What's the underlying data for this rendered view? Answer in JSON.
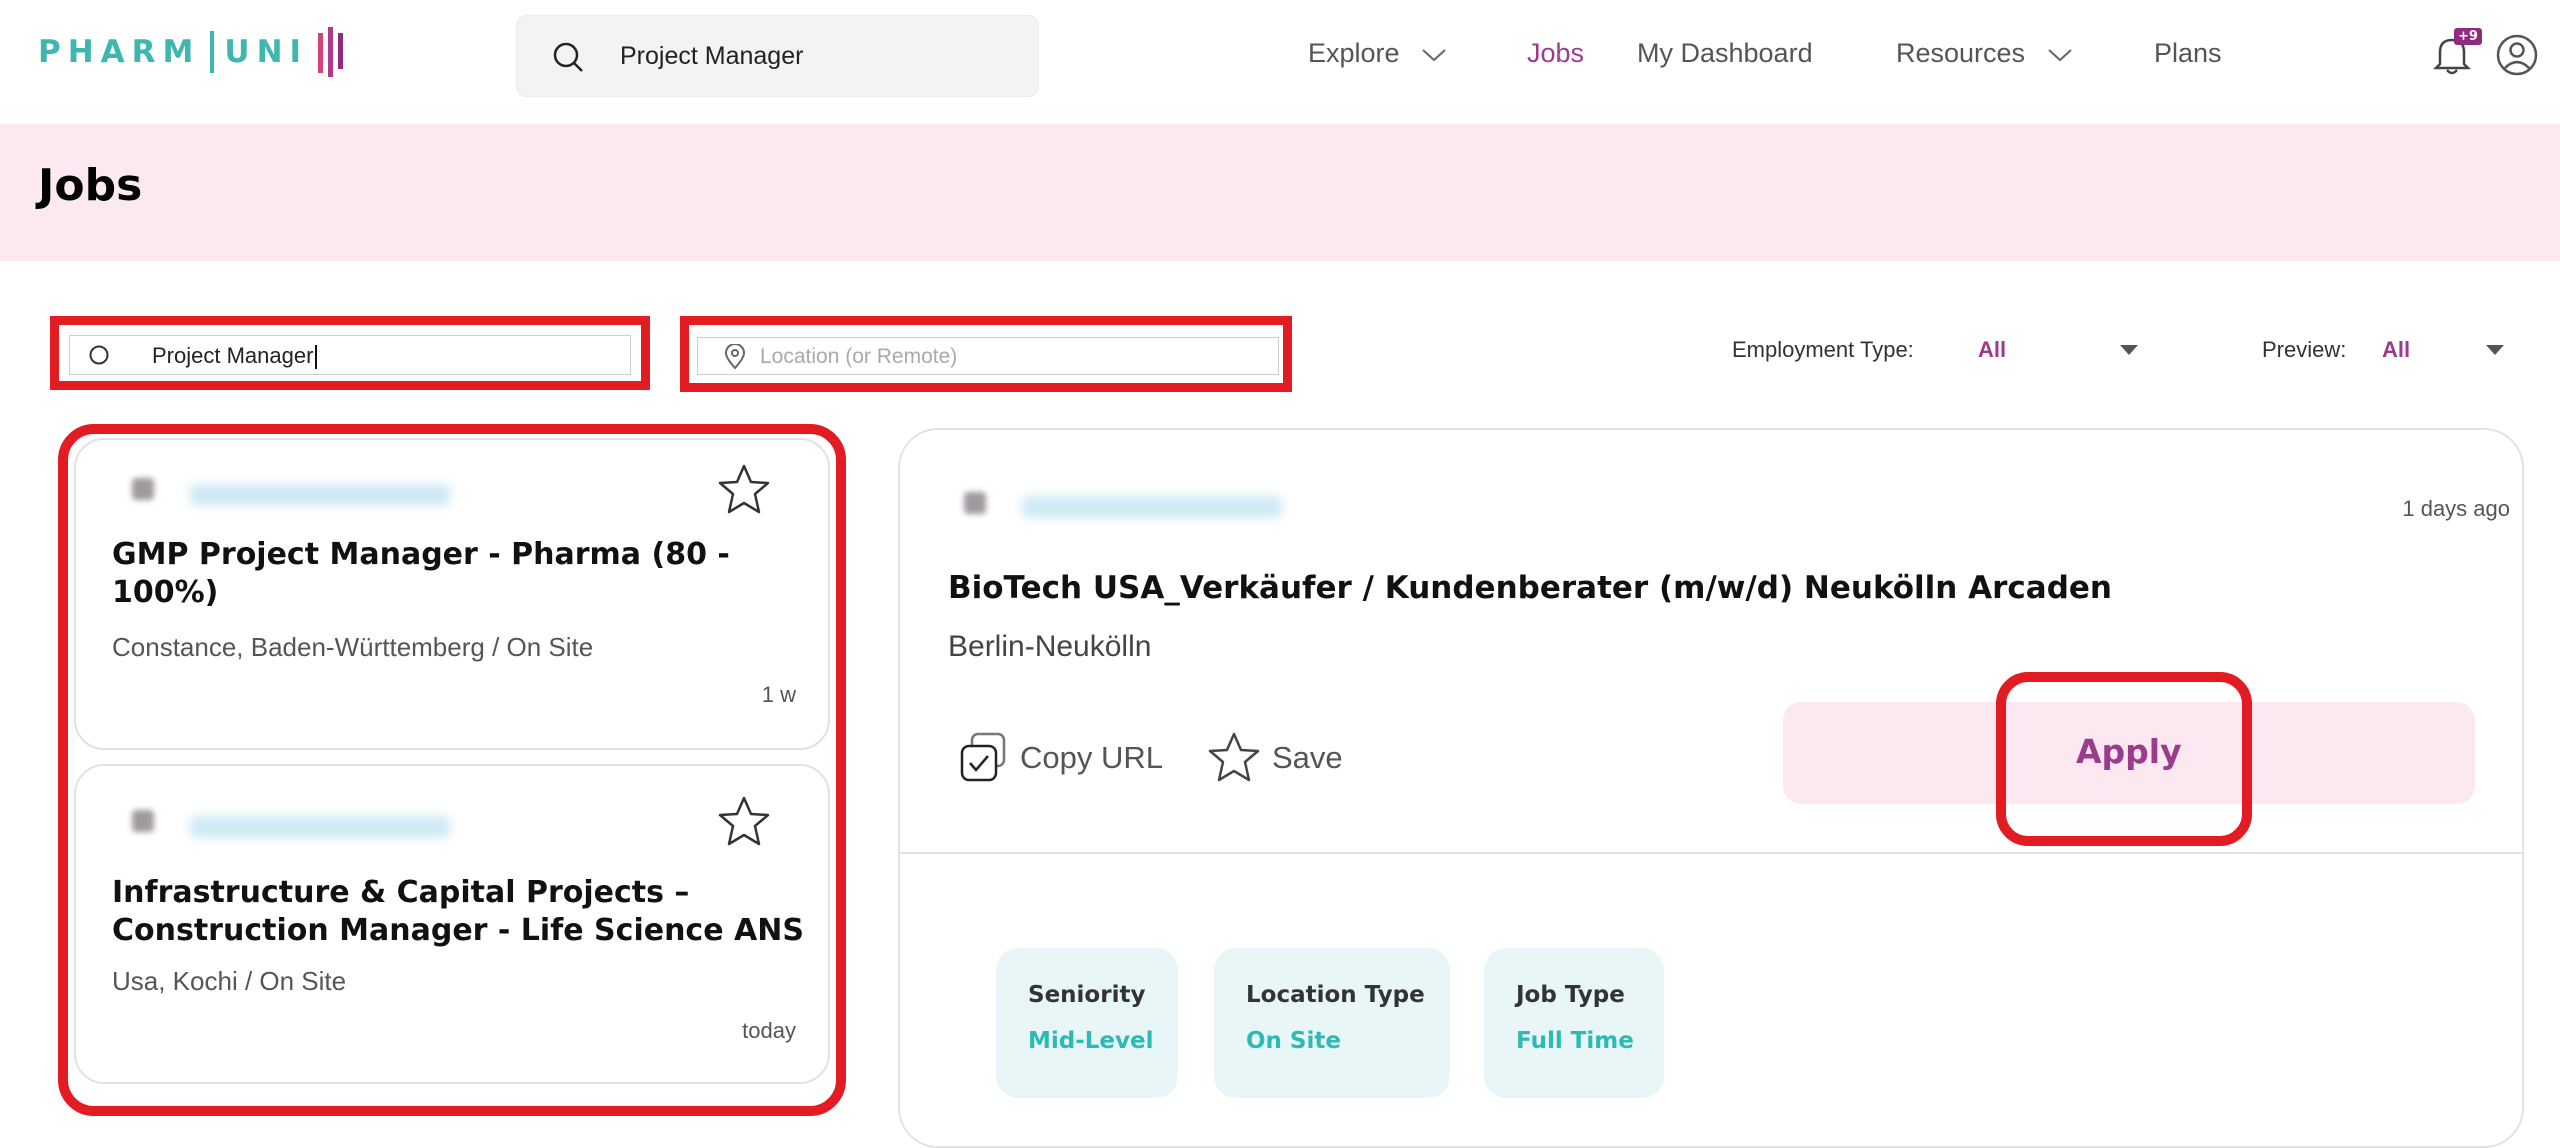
{
  "brand": {
    "name_left": "PHARM",
    "name_right": "UNI"
  },
  "header": {
    "search_value": "Project Manager",
    "nav": [
      {
        "label": "Explore",
        "has_dropdown": true
      },
      {
        "label": "Jobs",
        "active": true
      },
      {
        "label": "My Dashboard"
      },
      {
        "label": "Resources",
        "has_dropdown": true
      },
      {
        "label": "Plans"
      }
    ],
    "notification_badge": "+9"
  },
  "page": {
    "title": "Jobs"
  },
  "filters": {
    "search_value": "Project Manager",
    "location_placeholder": "Location (or Remote)",
    "employment_type_label": "Employment Type:",
    "employment_type_value": "All",
    "preview_label": "Preview:",
    "preview_value": "All"
  },
  "job_list": [
    {
      "title": "GMP Project Manager - Pharma (80 - 100%)",
      "location": "Constance, Baden-Württemberg / On Site",
      "age": "1 w"
    },
    {
      "title": "Infrastructure & Capital Projects – Construction Manager - Life Science ANS",
      "location": "Usa, Kochi / On Site",
      "age": "today"
    }
  ],
  "detail": {
    "posted": "1 days ago",
    "title": "BioTech USA_Verkäufer / Kundenberater (m/w/d) Neukölln Arcaden",
    "location": "Berlin-Neukölln",
    "copy_url_label": "Copy URL",
    "save_label": "Save",
    "apply_label": "Apply",
    "attributes": [
      {
        "label": "Seniority",
        "value": "Mid-Level"
      },
      {
        "label": "Location Type",
        "value": "On Site"
      },
      {
        "label": "Job Type",
        "value": "Full Time"
      }
    ]
  },
  "colors": {
    "brand_teal": "#3fb7b0",
    "accent_purple": "#9c3a8e",
    "highlight_red": "#e31b23",
    "header_pink": "#fbe8f1",
    "tag_teal": "#2cbab2"
  }
}
